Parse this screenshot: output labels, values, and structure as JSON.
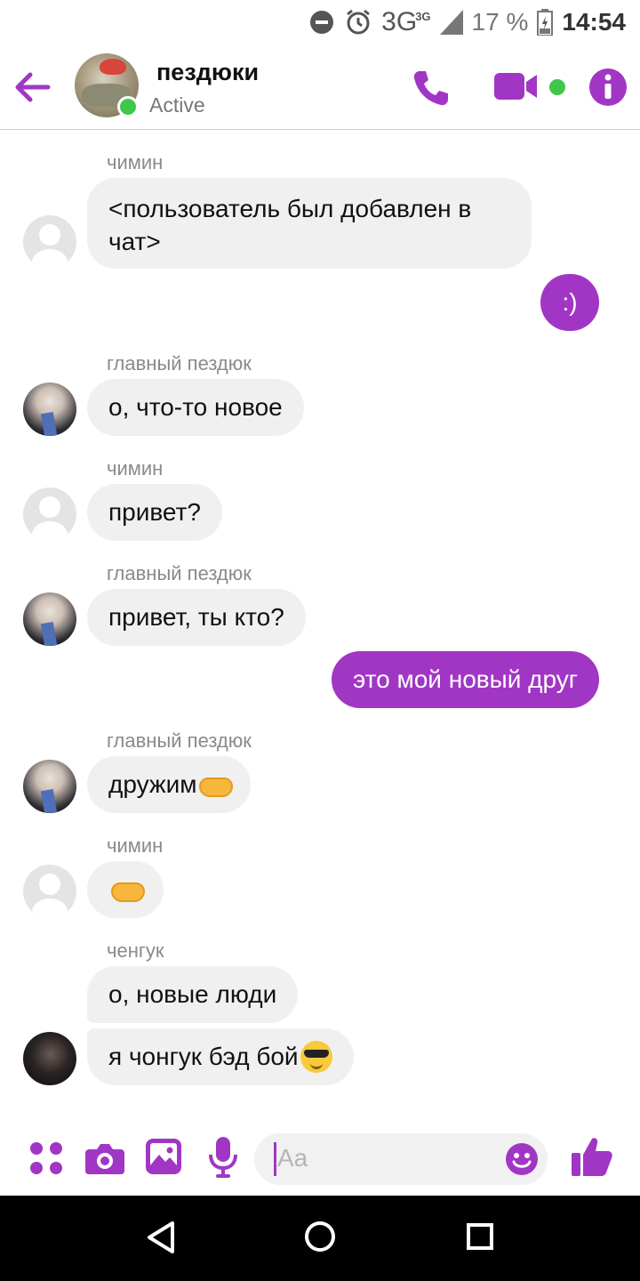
{
  "status_bar": {
    "network": "3G",
    "network_small": "3G",
    "battery": "17 %",
    "time": "14:54"
  },
  "header": {
    "title": "пездюки",
    "subtitle": "Active"
  },
  "messages": [
    {
      "sender": "чимин",
      "text": "<пользователь был добавлен в чат>",
      "avatar": "default"
    },
    {
      "direction": "outgoing",
      "text": ":)"
    },
    {
      "sender": "главный пездюк",
      "text": "о, что-то новое",
      "avatar": "photo"
    },
    {
      "sender": "чимин",
      "text": "привет?",
      "avatar": "default"
    },
    {
      "sender": "главный пездюк",
      "text": "привет, ты кто?",
      "avatar": "photo"
    },
    {
      "direction": "outgoing",
      "text": "это мой новый друг"
    },
    {
      "sender": "главный пездюк",
      "text": "дружим",
      "emoji": "handshake",
      "avatar": "photo"
    },
    {
      "sender": "чимин",
      "text": "",
      "emoji": "handshake",
      "avatar": "default"
    },
    {
      "sender": "ченгук",
      "text": "о, новые люди"
    },
    {
      "text": "я чонгук бэд бой",
      "emoji": "sunglasses-face",
      "avatar": "dark"
    }
  ],
  "composer": {
    "placeholder": "Aa"
  },
  "colors": {
    "accent": "#a136c5",
    "bubble_in": "#f0f0f0",
    "online": "#3fc74a"
  },
  "icons": [
    "back-arrow-icon",
    "phone-icon",
    "video-camera-icon",
    "info-icon",
    "apps-grid-icon",
    "camera-icon",
    "image-icon",
    "microphone-icon",
    "emoji-icon",
    "thumbs-up-icon",
    "nav-back-icon",
    "nav-home-icon",
    "nav-recents-icon"
  ]
}
